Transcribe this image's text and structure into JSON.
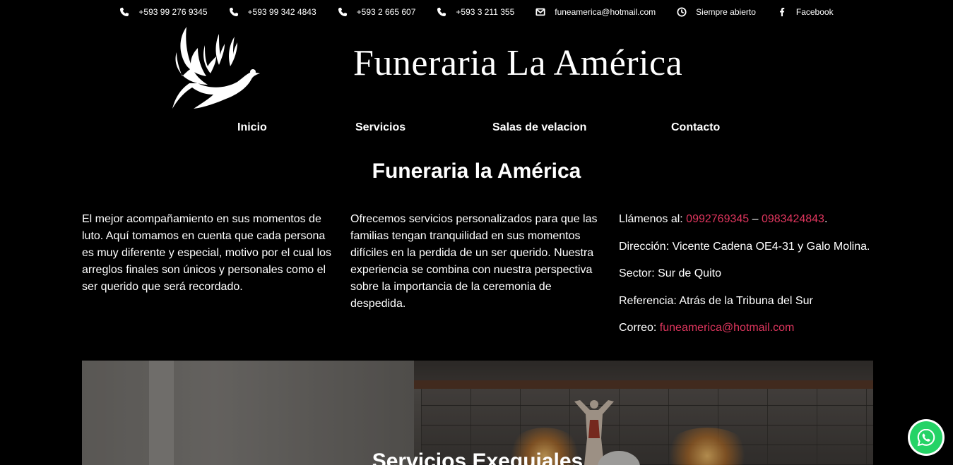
{
  "topbar": {
    "items": [
      {
        "icon": "phone-icon",
        "label": "+593 99 276 9345"
      },
      {
        "icon": "phone-icon",
        "label": "+593 99 342 4843"
      },
      {
        "icon": "phone-icon",
        "label": "+593 2 665 607"
      },
      {
        "icon": "phone-icon",
        "label": "+593 3 211 355"
      },
      {
        "icon": "envelope-icon",
        "label": "funeamerica@hotmail.com"
      },
      {
        "icon": "clock-icon",
        "label": "Siempre abierto"
      },
      {
        "icon": "facebook-icon",
        "label": "Facebook"
      }
    ]
  },
  "header": {
    "logo_icon": "dove-logo-icon",
    "title": "Funeraria La América"
  },
  "nav": {
    "items": [
      "Inicio",
      "Servicios",
      "Salas de velacion",
      "Contacto"
    ]
  },
  "main": {
    "heading": "Funeraria la América",
    "col1": "El mejor acompañamiento en sus momentos de luto. Aquí tomamos en cuenta que cada persona es muy diferente y especial, motivo por el cual los arreglos finales son únicos y personales como el ser querido que será recordado.",
    "col2": "Ofrecemos servicios personalizados para que las familias tengan tranquilidad en sus momentos difíciles en la perdida de un ser querido. Nuestra experiencia se combina con nuestra perspectiva sobre la importancia de la ceremonia de despedida.",
    "contact": {
      "call_label": "Llámenos al: ",
      "phone1": "0992769345",
      "separator": " – ",
      "phone2": "0983424843",
      "period": ".",
      "address": "Dirección: Vicente Cadena OE4-31 y Galo Molina.",
      "sector": "Sector: Sur de Quito",
      "reference": "Referencia: Atrás de la Tribuna del Sur",
      "email_label": "Correo: ",
      "email": "funeamerica@hotmail.com"
    }
  },
  "hero": {
    "title": "Servicios Exequiales"
  },
  "whatsapp": {
    "icon": "whatsapp-icon"
  },
  "colors": {
    "background": "#000000",
    "text": "#ffffff",
    "link": "#e0365e",
    "whatsapp": "#25d366"
  }
}
